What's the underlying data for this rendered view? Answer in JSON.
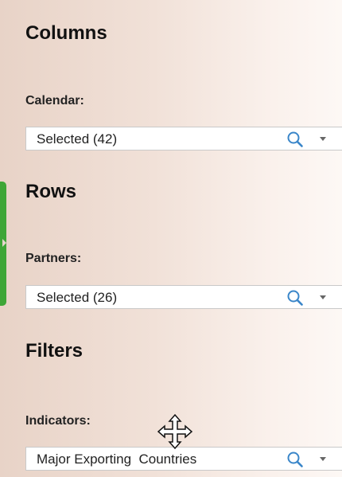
{
  "columns": {
    "title": "Columns",
    "field_label": "Calendar:",
    "selected_value": "Selected (42)"
  },
  "rows": {
    "title": "Rows",
    "field_label": "Partners:",
    "selected_value": "Selected (26)"
  },
  "filters": {
    "title": "Filters",
    "field_label": "Indicators:",
    "selected_value": "Major Exporting  Countries"
  },
  "icons": {
    "search": "search-icon",
    "dropdown": "chevron-down-icon",
    "cursor": "move-cursor-icon"
  },
  "colors": {
    "panel_handle": "#3ea637",
    "search_icon": "#3a86c9"
  }
}
